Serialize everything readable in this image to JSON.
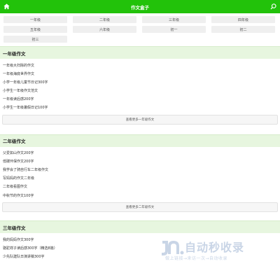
{
  "header": {
    "title": "作文盒子",
    "home_icon": "home-icon",
    "search_icon": "search-icon",
    "accent": "#22c20a"
  },
  "grades": [
    "一年级",
    "二年级",
    "三年级",
    "四年级",
    "五年级",
    "六年级",
    "初一",
    "初二",
    "初三"
  ],
  "sections": [
    {
      "title": "一年级作文",
      "items": [
        "一年级大扫除的作文",
        "一年级海底世界作文",
        "小学一年级儿童节日记300字",
        "小学生一年级作文范文",
        "一年级读后感200字",
        "小学生一年级暑假日记100字"
      ],
      "more": "查看更多一年级作文"
    },
    {
      "title": "二年级作文",
      "items": [
        "父爱如山作文200字",
        "低碳环保作文200字",
        "我学会了骑自行车二年级作文",
        "写妈妈的作文二年级",
        "二年级看图作文",
        "中秋节的作文100字"
      ],
      "more": "查看更多二年级作文"
    },
    {
      "title": "三年级作文",
      "items": [
        "我的妈妈作文300字",
        "骆驼祥子读后感300字（精选8篇）",
        "少先队建队日演讲稿300字"
      ]
    }
  ],
  "watermark": {
    "brand": "自动秒收录",
    "sub": "做上链接→来访一次→自动收录"
  }
}
